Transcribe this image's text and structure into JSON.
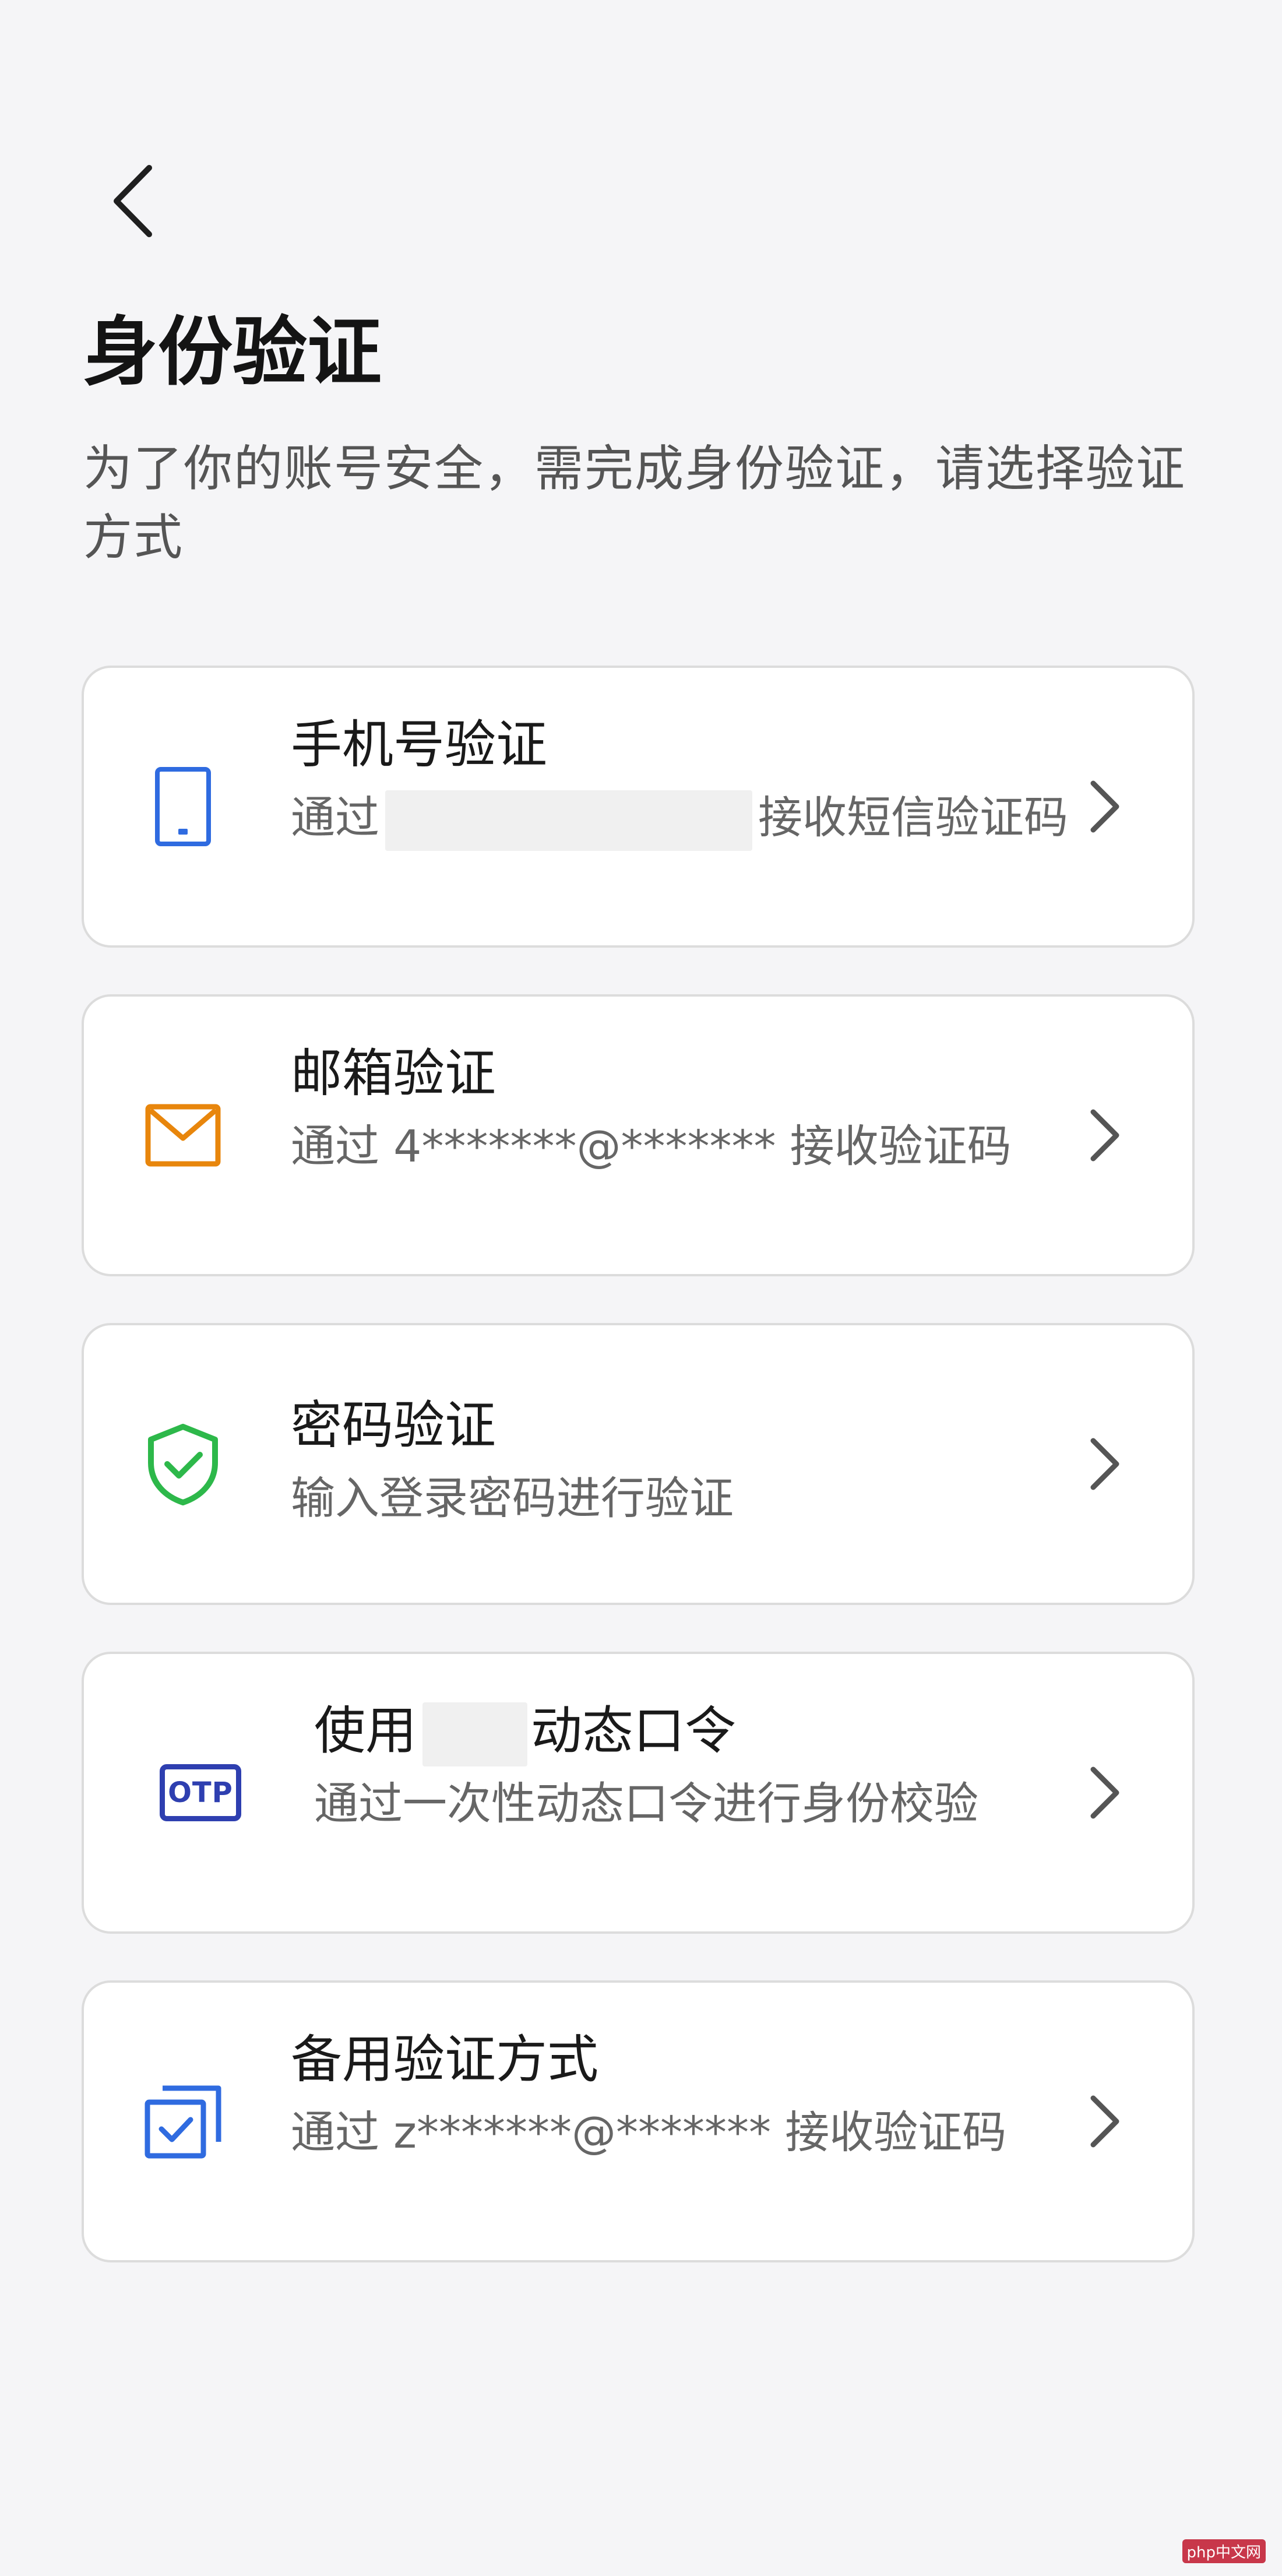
{
  "header": {
    "title": "身份验证",
    "description": "为了你的账号安全，需完成身份验证，请选择验证方式"
  },
  "methods": [
    {
      "title": "手机号验证",
      "subtitle_prefix": "通过",
      "subtitle_suffix": "接收短信验证码",
      "icon": "phone-icon",
      "color": "#2f6be0"
    },
    {
      "title": "邮箱验证",
      "subtitle": "通过 4*******@******* 接收验证码",
      "icon": "mail-icon",
      "color": "#e8860c"
    },
    {
      "title": "密码验证",
      "subtitle": "输入登录密码进行验证",
      "icon": "shield-check-icon",
      "color": "#2db84a"
    },
    {
      "title_prefix": "使用",
      "title_suffix": "动态口令",
      "subtitle": "通过一次性动态口令进行身份校验",
      "icon": "otp-icon",
      "icon_text": "OTP",
      "color": "#2e3fb0"
    },
    {
      "title": "备用验证方式",
      "subtitle": "通过 z*******@******* 接收验证码",
      "icon": "backup-check-icon",
      "color": "#2f6be0"
    }
  ],
  "watermark": "php中文网"
}
